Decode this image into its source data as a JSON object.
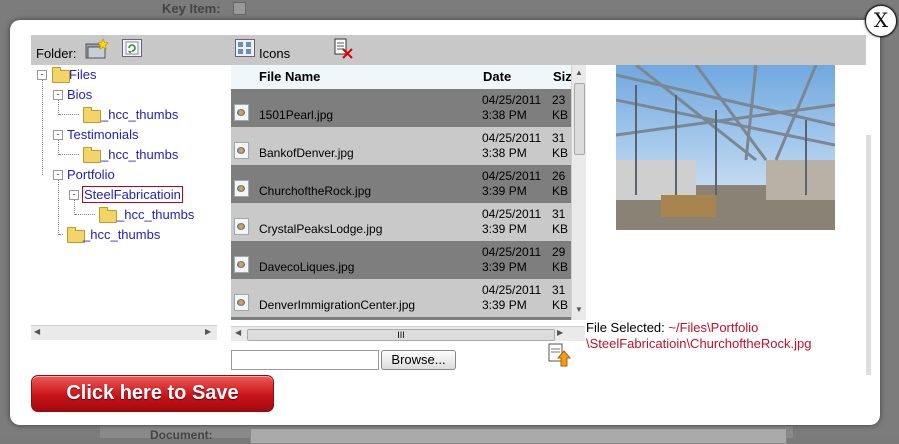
{
  "background": {
    "key_item_label": "Key Item:",
    "document_label": "Document:"
  },
  "dialog": {
    "close_label": "X",
    "toolbar": {
      "folder_label": "Folder:",
      "view_label": "Icons",
      "icons": [
        "new-folder-icon",
        "refresh-icon",
        "view-icons-icon",
        "delete-file-icon"
      ]
    },
    "tree": {
      "nodes": [
        {
          "label": "Files",
          "level": 0
        },
        {
          "label": "Bios",
          "level": 1
        },
        {
          "label": "_hcc_thumbs",
          "level": 2
        },
        {
          "label": "Testimonials",
          "level": 1
        },
        {
          "label": "_hcc_thumbs",
          "level": 2
        },
        {
          "label": "Portfolio",
          "level": 1
        },
        {
          "label": "SteelFabricatioin",
          "level": 2,
          "selected": true
        },
        {
          "label": "_hcc_thumbs",
          "level": 3
        },
        {
          "label": "_hcc_thumbs",
          "level": 2
        }
      ]
    },
    "file_list": {
      "headers": {
        "name": "File Name",
        "date": "Date",
        "size": "Siz"
      },
      "rows": [
        {
          "name": "1501Pearl.jpg",
          "date": "04/25/2011",
          "time": "3:38 PM",
          "size": "23",
          "unit": "KB"
        },
        {
          "name": "BankofDenver.jpg",
          "date": "04/25/2011",
          "time": "3:38 PM",
          "size": "31",
          "unit": "KB"
        },
        {
          "name": "ChurchoftheRock.jpg",
          "date": "04/25/2011",
          "time": "3:39 PM",
          "size": "26",
          "unit": "KB"
        },
        {
          "name": "CrystalPeaksLodge.jpg",
          "date": "04/25/2011",
          "time": "3:39 PM",
          "size": "31",
          "unit": "KB"
        },
        {
          "name": "DavecoLiques.jpg",
          "date": "04/25/2011",
          "time": "3:39 PM",
          "size": "29",
          "unit": "KB"
        },
        {
          "name": "DenverImmigrationCenter.jpg",
          "date": "04/25/2011",
          "time": "3:39 PM",
          "size": "31",
          "unit": "KB"
        }
      ],
      "scroll_grip": "III"
    },
    "file_selected": {
      "label": "File Selected:",
      "path_line1": "~/Files\\Portfolio",
      "path_line2": "\\SteelFabricatioin\\ChurchoftheRock.jpg"
    },
    "upload": {
      "file_value": "",
      "browse_label": "Browse..."
    },
    "save_label": "Click here to Save"
  }
}
